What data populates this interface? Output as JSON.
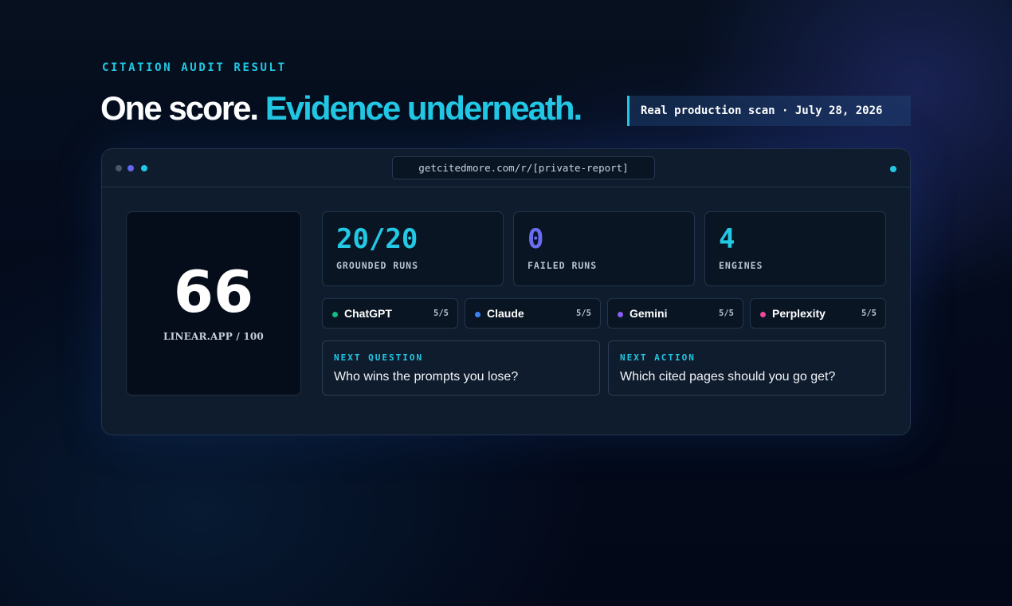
{
  "eyebrow": "CITATION AUDIT RESULT",
  "headline": {
    "part1": "One score.",
    "part2": "Evidence underneath."
  },
  "scan_badge": "Real production scan · July 28, 2026",
  "window": {
    "url": "getcitedmore.com/r/[private-report]",
    "traffic_colors": [
      "#4b5563",
      "#6366f1",
      "#22c8e4"
    ],
    "live_color": "#22c8e4"
  },
  "score": {
    "value": "66",
    "label": "LINEAR.APP / 100"
  },
  "stats": [
    {
      "value": "20/20",
      "label": "GROUNDED RUNS",
      "color": "#22c8e4"
    },
    {
      "value": "0",
      "label": "FAILED RUNS",
      "color": "#6a6cf0"
    },
    {
      "value": "4",
      "label": "ENGINES",
      "color": "#22c8e4"
    }
  ],
  "engines": [
    {
      "name": "ChatGPT",
      "score": "5/5",
      "color": "#16b981"
    },
    {
      "name": "Claude",
      "score": "5/5",
      "color": "#3b82f6"
    },
    {
      "name": "Gemini",
      "score": "5/5",
      "color": "#8b5cf6"
    },
    {
      "name": "Perplexity",
      "score": "5/5",
      "color": "#ec4899"
    }
  ],
  "next": [
    {
      "kicker": "NEXT QUESTION",
      "text": "Who wins the prompts you lose?"
    },
    {
      "kicker": "NEXT ACTION",
      "text": "Which cited pages should you go get?"
    }
  ],
  "colors": {
    "accent": "#22c8e4",
    "background": "#030a1a",
    "panel": "#0f1c2d"
  }
}
